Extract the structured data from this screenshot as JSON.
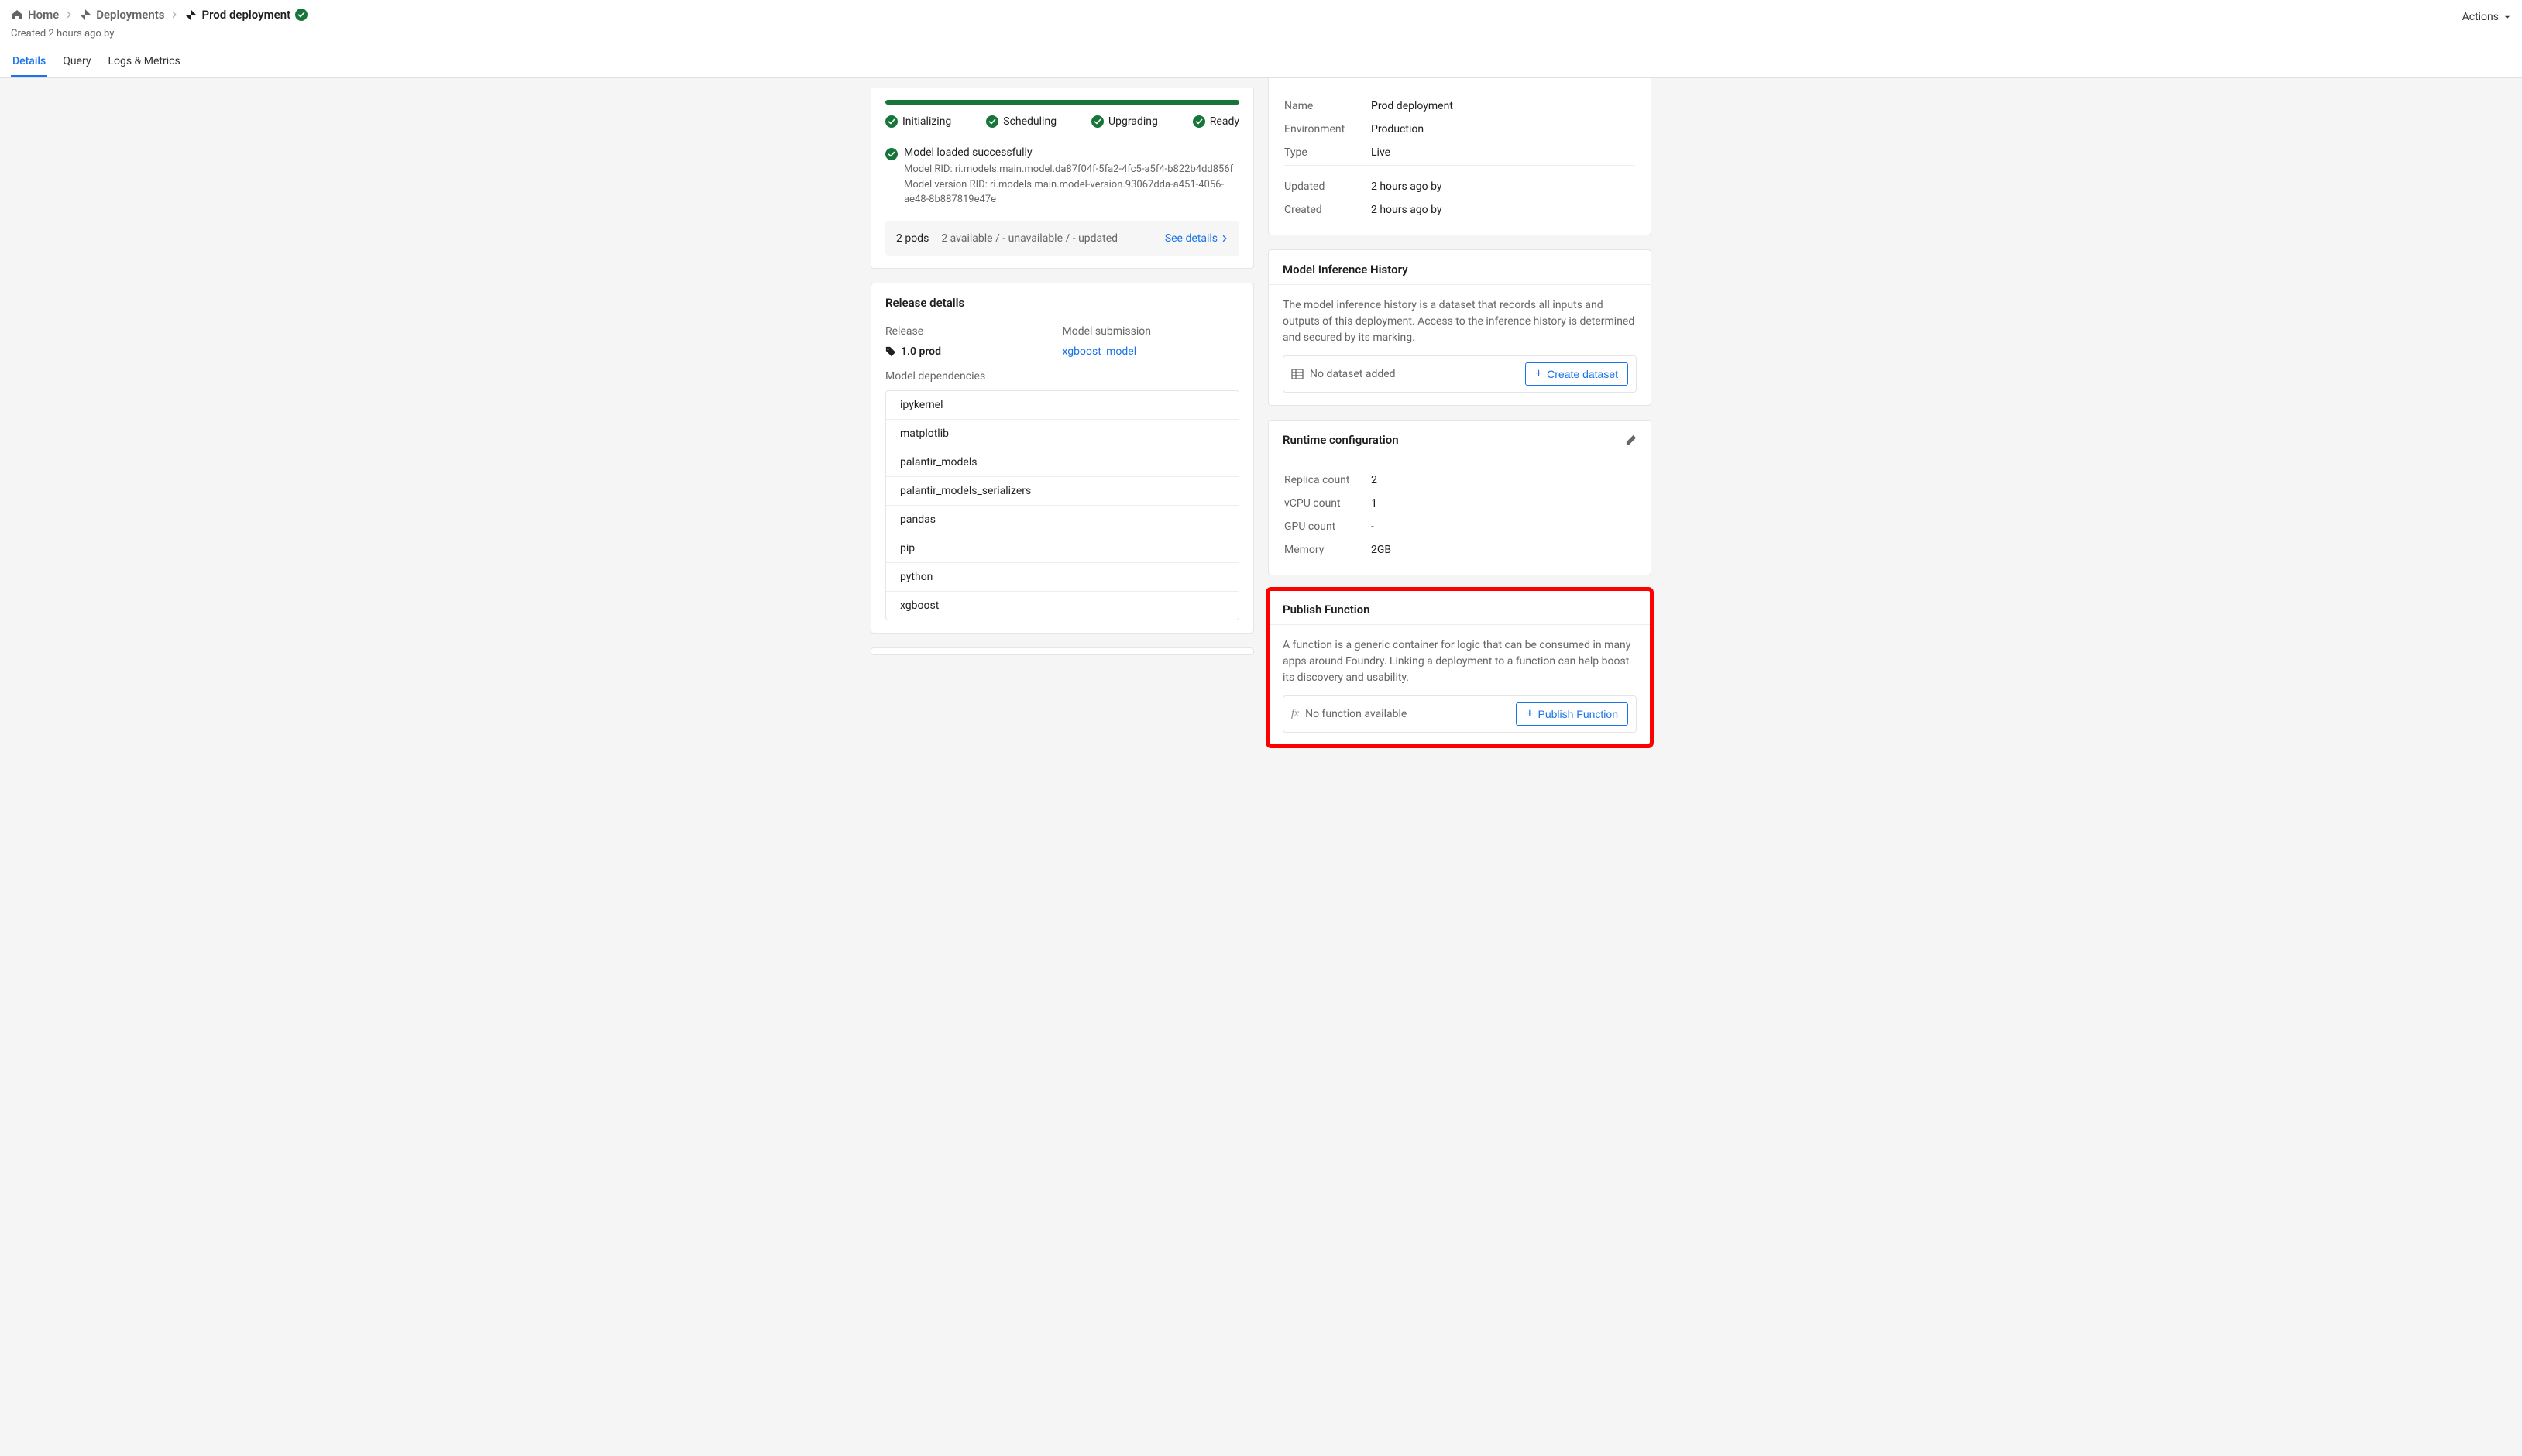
{
  "header": {
    "breadcrumb": {
      "home": "Home",
      "deployments": "Deployments",
      "current": "Prod deployment"
    },
    "subtitle": "Created 2 hours ago by",
    "actions": "Actions"
  },
  "tabs": {
    "details": "Details",
    "query": "Query",
    "logs": "Logs & Metrics"
  },
  "status": {
    "stages": {
      "initializing": "Initializing",
      "scheduling": "Scheduling",
      "upgrading": "Upgrading",
      "ready": "Ready"
    },
    "loaded": "Model loaded successfully",
    "model_rid": "Model RID: ri.models.main.model.da87f04f-5fa2-4fc5-a5f4-b822b4dd856f",
    "version_rid": "Model version RID: ri.models.main.model-version.93067dda-a451-4056-ae48-8b887819e47e",
    "pods_count": "2 pods",
    "pods_avail": "2 available / - unavailable / - updated",
    "see_details": "See details"
  },
  "release": {
    "title": "Release details",
    "release_label": "Release",
    "release_value": "1.0 prod",
    "submission_label": "Model submission",
    "submission_link": "xgboost_model",
    "deps_label": "Model dependencies",
    "deps": [
      "ipykernel",
      "matplotlib",
      "palantir_models",
      "palantir_models_serializers",
      "pandas",
      "pip",
      "python",
      "xgboost"
    ]
  },
  "meta": {
    "rows": {
      "name_label": "Name",
      "name_value": "Prod deployment",
      "env_label": "Environment",
      "env_value": "Production",
      "type_label": "Type",
      "type_value": "Live",
      "updated_label": "Updated",
      "updated_value": "2 hours ago by",
      "created_label": "Created",
      "created_value": "2 hours ago by"
    }
  },
  "inference": {
    "title": "Model Inference History",
    "desc": "The model inference history is a dataset that records all inputs and outputs of this deployment. Access to the inference history is determined and secured by its marking.",
    "no_dataset": "No dataset added",
    "create": "Create dataset"
  },
  "runtime": {
    "title": "Runtime configuration",
    "replica_label": "Replica count",
    "replica_value": "2",
    "vcpu_label": "vCPU count",
    "vcpu_value": "1",
    "gpu_label": "GPU count",
    "gpu_value": "-",
    "memory_label": "Memory",
    "memory_value": "2GB"
  },
  "publish": {
    "title": "Publish Function",
    "desc": "A function is a generic container for logic that can be consumed in many apps around Foundry. Linking a deployment to a function can help boost its discovery and usability.",
    "no_function": "No function available",
    "button": "Publish Function"
  }
}
